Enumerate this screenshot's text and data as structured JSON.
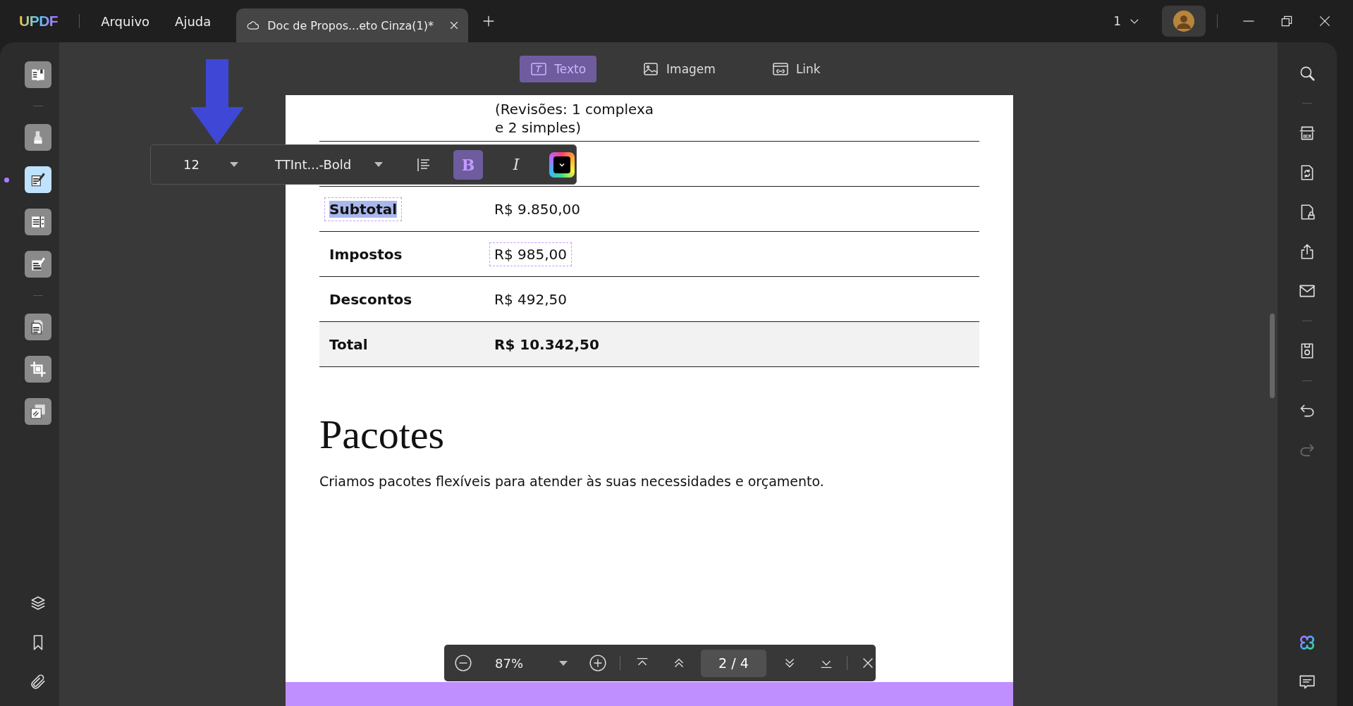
{
  "app": {
    "logo": "UPDF"
  },
  "menu": [
    {
      "label": "Arquivo"
    },
    {
      "label": "Ajuda"
    }
  ],
  "tab": {
    "title": "Doc de Propos...eto Cinza(1)*"
  },
  "page_selector": {
    "value": "1"
  },
  "edit_modes": [
    {
      "kind": "text",
      "label": "Texto",
      "selected": true
    },
    {
      "kind": "image",
      "label": "Imagem",
      "selected": false
    },
    {
      "kind": "link",
      "label": "Link",
      "selected": false
    }
  ],
  "left_tool_groups": [
    [
      {
        "kind": "reader",
        "selected": false
      }
    ],
    [
      {
        "kind": "comment",
        "selected": false
      },
      {
        "kind": "edit",
        "selected": true
      },
      {
        "kind": "form",
        "selected": false
      },
      {
        "kind": "fill",
        "selected": false
      }
    ],
    [
      {
        "kind": "organize",
        "selected": false
      },
      {
        "kind": "crop",
        "selected": false
      },
      {
        "kind": "overlay",
        "selected": false
      }
    ]
  ],
  "left_bottom_tools": [
    {
      "kind": "layers"
    },
    {
      "kind": "bookmark"
    },
    {
      "kind": "attachment"
    }
  ],
  "right_tool_groups": [
    [
      {
        "kind": "search",
        "disabled": false
      }
    ],
    [
      {
        "kind": "ocr",
        "disabled": false
      },
      {
        "kind": "convert",
        "disabled": false
      },
      {
        "kind": "protect",
        "disabled": false
      },
      {
        "kind": "share",
        "disabled": false
      },
      {
        "kind": "email",
        "disabled": false
      }
    ],
    [
      {
        "kind": "save",
        "disabled": false
      }
    ],
    [
      {
        "kind": "undo",
        "disabled": false
      },
      {
        "kind": "redo",
        "disabled": true
      }
    ]
  ],
  "right_bottom_tools": [
    {
      "kind": "ai"
    },
    {
      "kind": "comment"
    }
  ],
  "format_toolbar": {
    "font_size": "12",
    "font_name": "TTInt...-Bold",
    "bold_label": "B",
    "bold": true,
    "italic_label": "I",
    "italic": false
  },
  "document": {
    "top_lines": [
      "(Revisões: 1 complexa",
      "e 2 simples)"
    ],
    "rows": [
      {
        "kind": "blank"
      },
      {
        "kind": "data",
        "label": "Subtotal",
        "value": "R$ 9.850,00",
        "label_selected": true,
        "value_hovered": false,
        "emphasized": false
      },
      {
        "kind": "data",
        "label": "Impostos",
        "value": "R$ 985,00",
        "label_selected": false,
        "value_hovered": true,
        "emphasized": false
      },
      {
        "kind": "data",
        "label": "Descontos",
        "value": "R$ 492,50",
        "label_selected": false,
        "value_hovered": false,
        "emphasized": false
      },
      {
        "kind": "data",
        "label": "Total",
        "value": "R$ 10.342,50",
        "label_selected": false,
        "value_hovered": false,
        "emphasized": true
      }
    ],
    "heading": "Pacotes",
    "paragraph": "Criamos pacotes flexíveis para atender às suas necessidades e orçamento."
  },
  "zoom_bar": {
    "zoom": "87%",
    "page": "2 / 4"
  }
}
